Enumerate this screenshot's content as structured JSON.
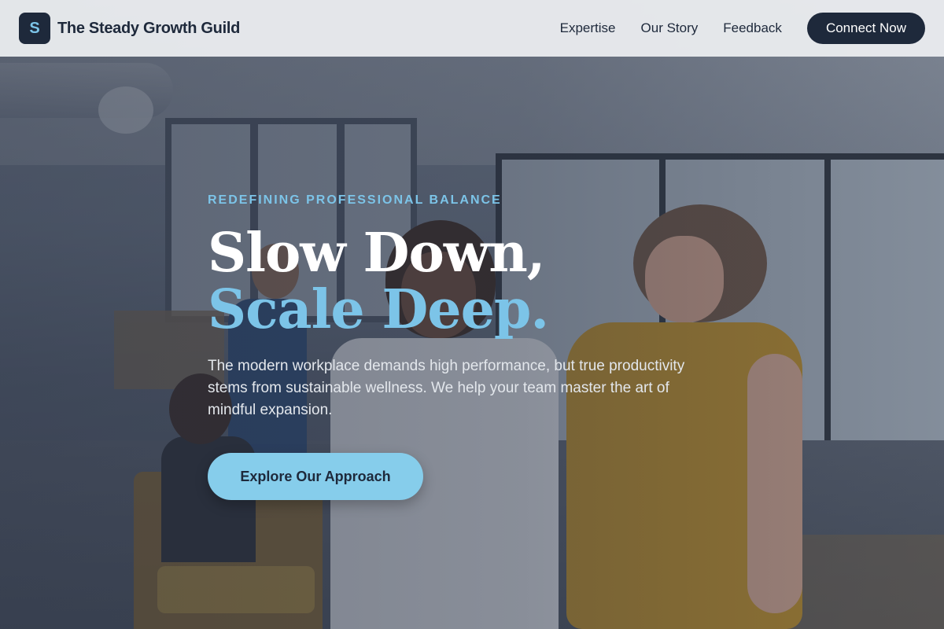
{
  "brand": {
    "logo_letter": "S",
    "name": "The Steady Growth Guild"
  },
  "nav": {
    "links": [
      "Expertise",
      "Our Story",
      "Feedback"
    ],
    "cta_label": "Connect Now"
  },
  "hero": {
    "eyebrow": "REDEFINING PROFESSIONAL BALANCE",
    "headline_line1": "Slow Down,",
    "headline_line2": "Scale Deep.",
    "subtext": "The modern workplace demands high performance, but true productivity stems from sustainable wellness. We help your team master the art of mindful expansion.",
    "cta_label": "Explore Our Approach"
  },
  "colors": {
    "primary_dark": "#1e293b",
    "accent_blue": "#7cc4e8",
    "header_bg": "#e9ebee"
  }
}
